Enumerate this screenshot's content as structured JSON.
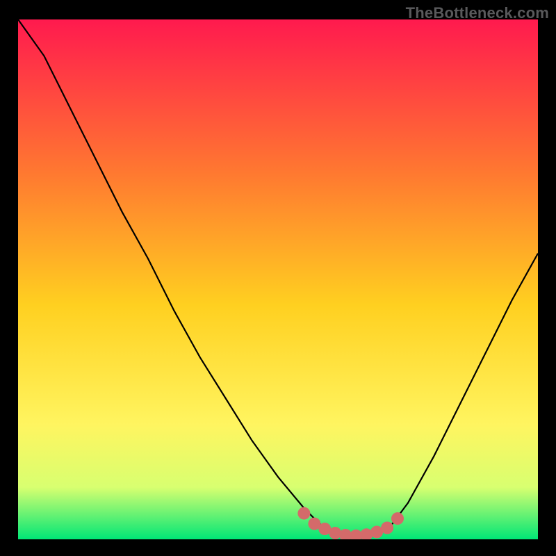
{
  "attribution": "TheBottleneck.com",
  "colors": {
    "gradient_top": "#ff1a4e",
    "gradient_mid1": "#ff7a30",
    "gradient_mid2": "#ffd020",
    "gradient_mid3": "#fff560",
    "gradient_mid4": "#d8ff70",
    "gradient_bottom": "#00e676",
    "stroke": "#000000",
    "marker": "#d46a6a"
  },
  "chart_data": {
    "type": "line",
    "title": "",
    "xlabel": "",
    "ylabel": "",
    "xlim": [
      0,
      100
    ],
    "ylim": [
      0,
      100
    ],
    "series": [
      {
        "name": "bottleneck-curve",
        "x": [
          0,
          5,
          10,
          15,
          20,
          25,
          30,
          35,
          40,
          45,
          50,
          55,
          58,
          60,
          62,
          64,
          66,
          68,
          70,
          72,
          75,
          80,
          85,
          90,
          95,
          100
        ],
        "y": [
          100,
          93,
          83,
          73,
          63,
          54,
          44,
          35,
          27,
          19,
          12,
          6,
          3,
          1.5,
          0.8,
          0.5,
          0.5,
          0.8,
          1.5,
          3,
          7,
          16,
          26,
          36,
          46,
          55
        ]
      }
    ],
    "markers": {
      "name": "highlight-points",
      "x": [
        55,
        57,
        59,
        61,
        63,
        65,
        67,
        69,
        71,
        73
      ],
      "y": [
        5,
        3,
        2,
        1.2,
        0.8,
        0.7,
        0.9,
        1.4,
        2.2,
        4
      ]
    }
  }
}
